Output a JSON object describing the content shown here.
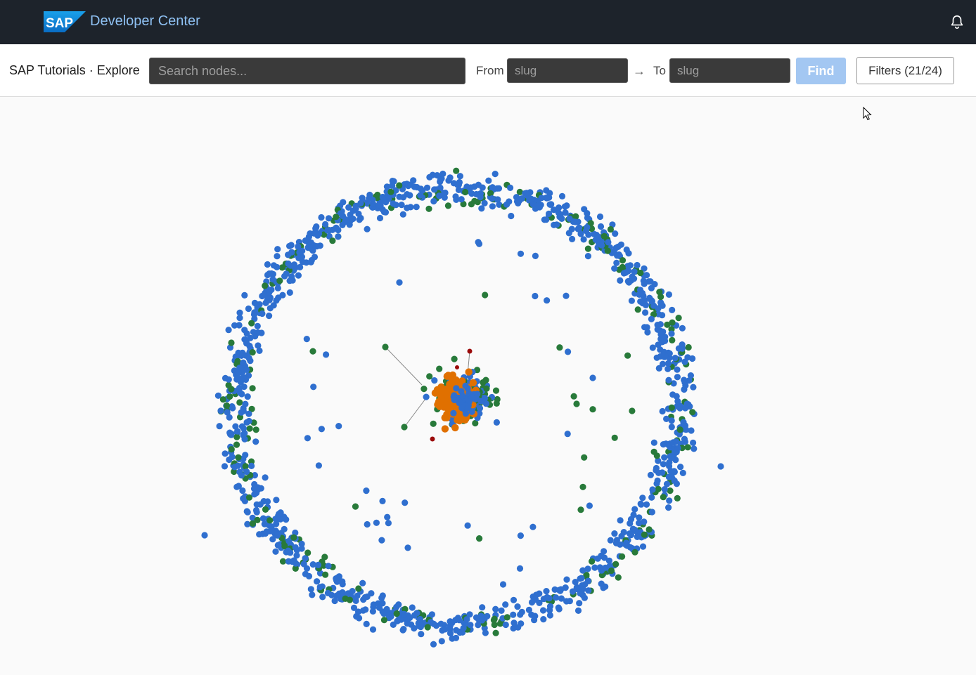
{
  "header": {
    "logo_text": "SAP",
    "title": "Developer Center",
    "bell_icon": "bell-icon"
  },
  "toolbar": {
    "title": "SAP Tutorials · Explore",
    "search_placeholder": "Search nodes...",
    "from_label": "From",
    "from_placeholder": "slug",
    "arrow": "→",
    "to_label": "To",
    "to_placeholder": "slug",
    "find_label": "Find",
    "filters_label": "Filters (21/24)"
  },
  "graph": {
    "colors": {
      "blue": "#2f6fcf",
      "green": "#287a3a",
      "orange": "#e07000",
      "red": "#9b0a0a",
      "edge": "#888888"
    }
  }
}
